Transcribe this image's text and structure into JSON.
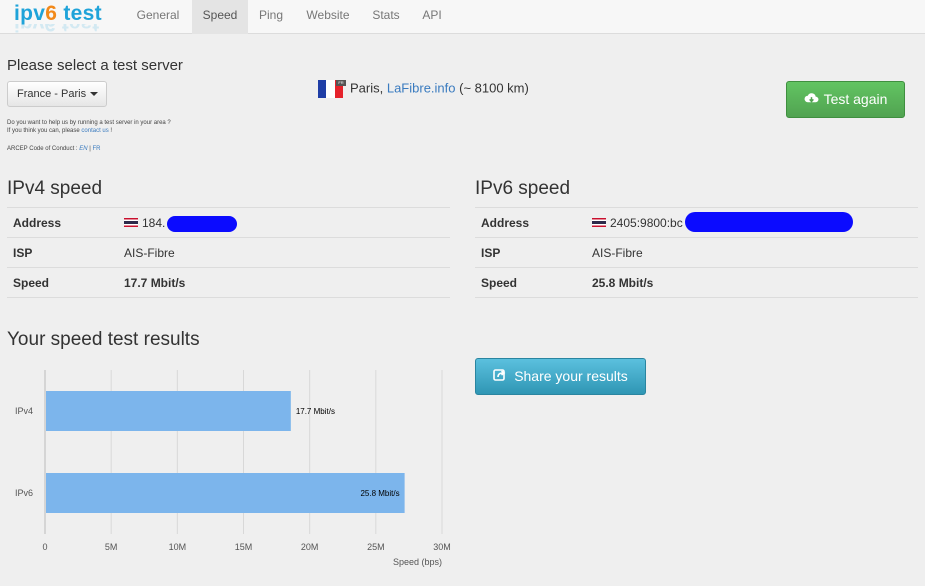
{
  "brand": {
    "part1": "ipv",
    "part2": "6",
    "part3": " test"
  },
  "nav": [
    {
      "label": "General"
    },
    {
      "label": "Speed"
    },
    {
      "label": "Ping"
    },
    {
      "label": "Website"
    },
    {
      "label": "Stats"
    },
    {
      "label": "API"
    }
  ],
  "nav_active": "Speed",
  "server": {
    "prompt": "Please select a test server",
    "dropdown_value": "France - Paris",
    "help_line1": "Do you want to help us by running a test server in your area ?",
    "help_line2_prefix": "If you think you can, please ",
    "help_line2_link": "contact us",
    "help_line2_suffix": " !",
    "arcep_prefix": "ARCEP Code of Conduct : ",
    "arcep_en": "EN",
    "arcep_sep": " | ",
    "arcep_fr": "FR",
    "city": "Paris, ",
    "host": "LaFibre.info",
    "distance": " (~ 8100 km)",
    "flag_label": "FR",
    "test_again_label": "Test again"
  },
  "ipv4": {
    "title": "IPv4 speed",
    "rows": [
      {
        "key": "Address",
        "value": "184."
      },
      {
        "key": "ISP",
        "value": "AIS-Fibre"
      },
      {
        "key": "Speed",
        "value": "17.7 Mbit/s"
      }
    ]
  },
  "ipv6": {
    "title": "IPv6 speed",
    "rows": [
      {
        "key": "Address",
        "value": "2405:9800:bc"
      },
      {
        "key": "ISP",
        "value": "AIS-Fibre"
      },
      {
        "key": "Speed",
        "value": "25.8 Mbit/s"
      }
    ]
  },
  "results": {
    "title": "Your speed test results",
    "share_label": "Share your results"
  },
  "colors": {
    "bar": "#7cb5ec",
    "test_again": "#5bb75b",
    "share": "#49afcd",
    "link": "#3a7bbf",
    "redaction": "#0b0bff"
  },
  "chart_data": {
    "type": "bar",
    "orientation": "horizontal",
    "categories": [
      "IPv4",
      "IPv6"
    ],
    "values": [
      18.5,
      27.1
    ],
    "data_labels": [
      "17.7 Mbit/s",
      "25.8 Mbit/s"
    ],
    "xlabel": "Speed (bps)",
    "ylabel": "",
    "xlim": [
      0,
      30000000
    ],
    "x_ticks": [
      "0",
      "5M",
      "10M",
      "15M",
      "20M",
      "25M",
      "30M"
    ],
    "x_tick_values": [
      0,
      5000000,
      10000000,
      15000000,
      20000000,
      25000000,
      30000000
    ],
    "bar_values_bps": [
      18500000,
      27100000
    ],
    "grid": "vertical"
  }
}
